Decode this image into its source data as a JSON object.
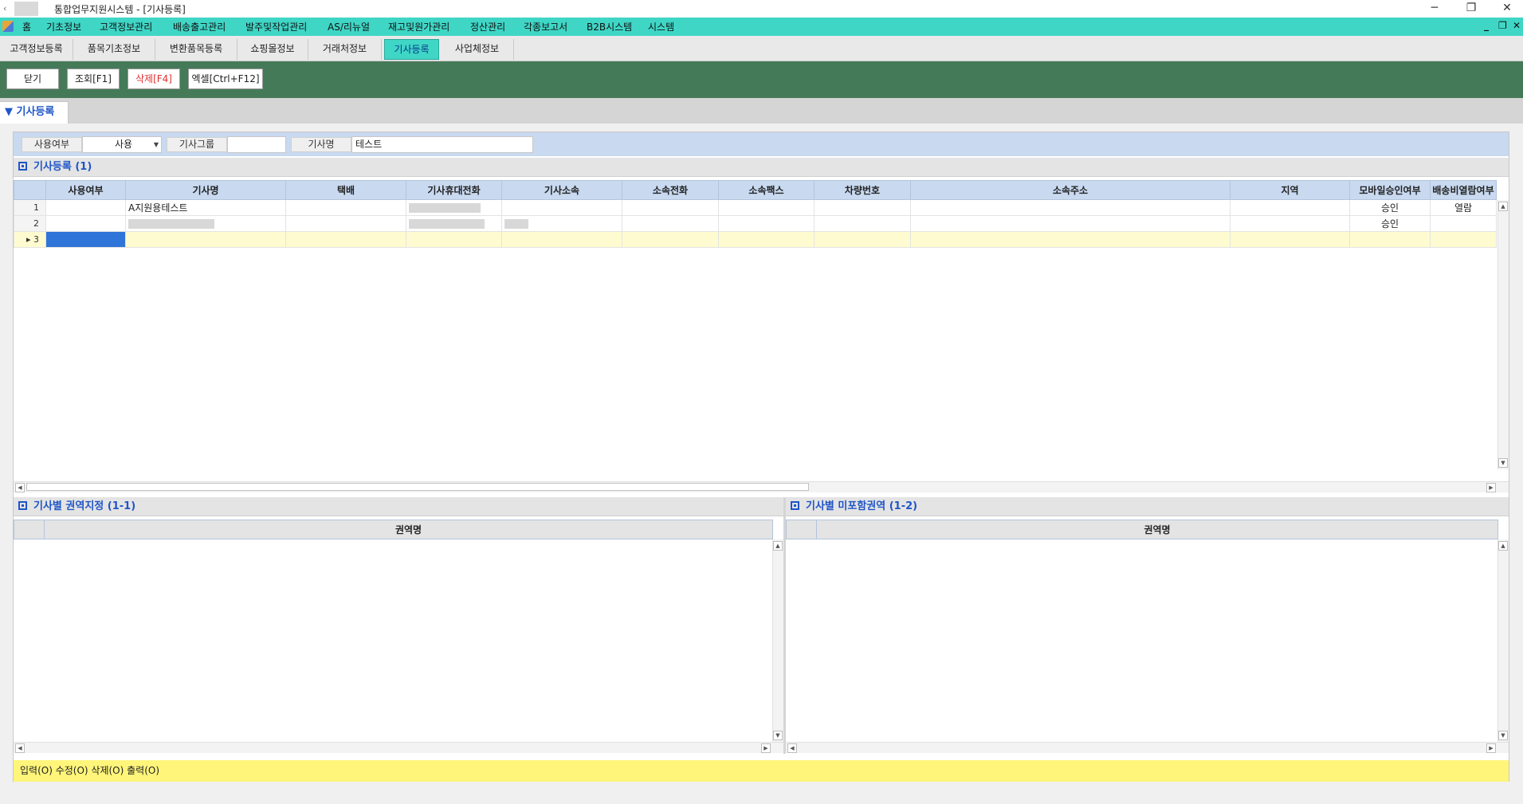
{
  "window": {
    "title": "통합업무지원시스템 - [기사등록]",
    "back_glyph": "‹",
    "min_glyph": "─",
    "restore_glyph": "❐",
    "close_glyph": "✕"
  },
  "menu": {
    "items": [
      "홈",
      "기초정보",
      "고객정보관리",
      "배송출고관리",
      "발주및작업관리",
      "AS/리뉴얼",
      "재고및원가관리",
      "정산관리",
      "각종보고서",
      "B2B시스템",
      "시스템"
    ],
    "mdi_min": "_",
    "mdi_restore": "❐",
    "mdi_close": "✕"
  },
  "module_tabs": [
    "고객정보등록",
    "품목기초정보",
    "변환품목등록",
    "쇼핑몰정보",
    "거래처정보",
    "기사등록",
    "사업체정보"
  ],
  "active_tab": "기사등록",
  "toolbar": {
    "close": "닫기",
    "search": "조회[F1]",
    "delete": "삭제[F4]",
    "excel": "엑셀[Ctrl+F12]"
  },
  "section_tab": "▼ 기사등록",
  "filter": {
    "use_label": "사용여부",
    "use_value": "사용",
    "group_label": "기사그룹",
    "group_value": "",
    "name_label": "기사명",
    "name_value": "테스트"
  },
  "grid_main": {
    "title": "기사등록 (1)",
    "columns": [
      "사용여부",
      "기사명",
      "택배",
      "기사휴대전화",
      "기사소속",
      "소속전화",
      "소속팩스",
      "차량번호",
      "소속주소",
      "지역",
      "모바일승인여부",
      "배송비열람여부"
    ],
    "rows": [
      {
        "num": "1",
        "use": "",
        "name": "A지원용테스트",
        "mobile_approval": "승인",
        "fee_view": "열람"
      },
      {
        "num": "2",
        "use": "",
        "name": "",
        "mobile_approval": "승인",
        "fee_view": ""
      },
      {
        "num": "3",
        "use": "",
        "name": "",
        "mobile_approval": "",
        "fee_view": ""
      }
    ]
  },
  "grid_left": {
    "title": "기사별 권역지정 (1-1)",
    "column": "권역명"
  },
  "grid_right": {
    "title": "기사별 미포함권역 (1-2)",
    "column": "권역명"
  },
  "status": "입력(O) 수정(O) 삭제(O) 출력(O)",
  "colors": {
    "menu_bg": "#3fd6c6",
    "toolbar_bg": "#457a59",
    "header_blue": "#c8d9f0",
    "title_blue": "#1f55c8",
    "status_bg": "#fff57a",
    "selected_cell": "#2f74d8"
  }
}
